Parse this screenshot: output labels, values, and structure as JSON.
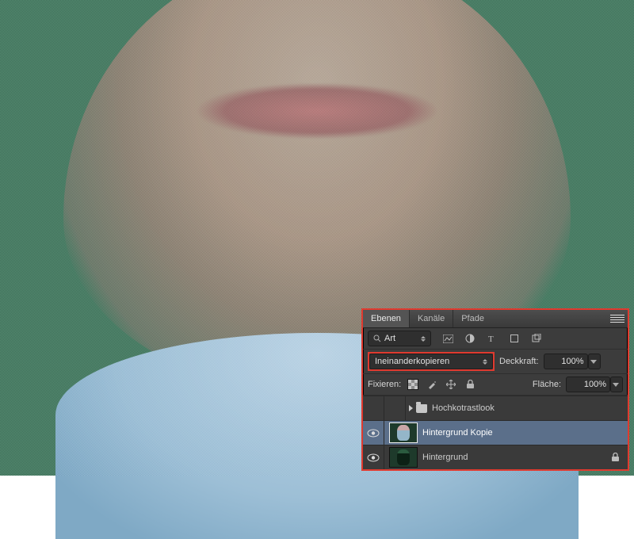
{
  "tabs": {
    "layers": "Ebenen",
    "channels": "Kanäle",
    "paths": "Pfade"
  },
  "filter": {
    "search_label": "Art"
  },
  "blend": {
    "mode": "Ineinanderkopieren"
  },
  "opacity": {
    "label": "Deckkraft:",
    "value": "100%"
  },
  "lock": {
    "label": "Fixieren:"
  },
  "fill": {
    "label": "Fläche:",
    "value": "100%"
  },
  "layers": {
    "group": "Hochkotrastlook",
    "copy": "Hintergrund Kopie",
    "bg": "Hintergrund"
  }
}
